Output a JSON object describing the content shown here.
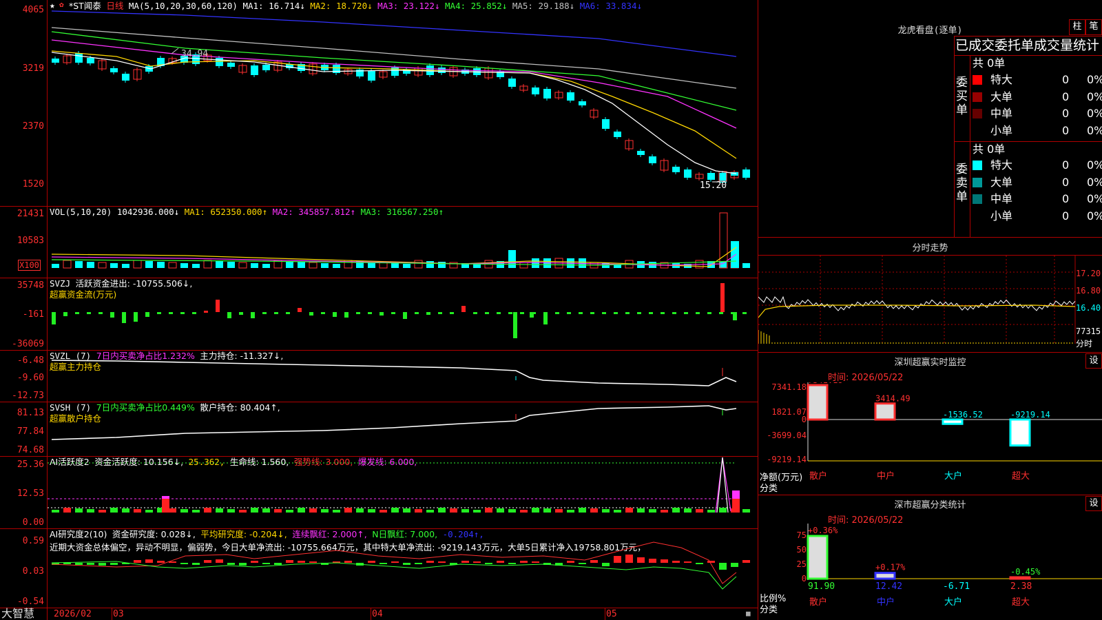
{
  "main": {
    "stock_name": "*ST闻泰",
    "period": "日线",
    "ma_header": {
      "label": "MA(5,10,20,30,60,120)",
      "ma1": "MA1: 16.714↓",
      "ma2": "MA2: 18.720↓",
      "ma3": "MA3: 23.122↓",
      "ma4": "MA4: 25.852↓",
      "ma5": "MA5: 29.188↓",
      "ma6": "MA6: 33.834↓"
    },
    "y_labels": [
      "4065",
      "3219",
      "2370",
      "1520"
    ],
    "high_label": "34.94",
    "low_label": "15.20"
  },
  "vol": {
    "header": {
      "label": "VOL(5,10,20)",
      "value": "1042936.000↓",
      "ma1": "MA1: 652350.000↑",
      "ma2": "MA2: 345857.812↑",
      "ma3": "MA3: 316567.250↑"
    },
    "y_labels": [
      "21431",
      "10583",
      "X100"
    ]
  },
  "svzj": {
    "header": {
      "label": "SVZJ",
      "text": "活跃资金进出: -10755.506↓,",
      "sub": "超赢资金流(万元)"
    },
    "y_labels": [
      "35748",
      "-161",
      "-36069"
    ]
  },
  "svzl": {
    "header": {
      "label": "SVZL (7)",
      "ratio": "7日内买卖净占比1.232%",
      "hold": "主力持仓: -11.327↓,",
      "sub": "超赢主力持仓"
    },
    "y_labels": [
      "-6.48",
      "-9.60",
      "-12.73"
    ]
  },
  "svsh": {
    "header": {
      "label": "SVSH (7)",
      "ratio": "7日内买卖净占比0.449%",
      "hold": "散户持仓: 80.404↑,",
      "sub": "超赢散户持仓"
    },
    "y_labels": [
      "81.13",
      "77.84",
      "74.68"
    ]
  },
  "ai_act": {
    "header": {
      "label": "AI活跃度2",
      "v1": "资金活跃度: 10.156↓,",
      "v2": "25.362,",
      "v3": "生命线: 1.560,",
      "v4": "强势线: 3.000,",
      "v5": "爆发线: 6.000,"
    },
    "y_labels": [
      "25.36",
      "12.53",
      "0.00"
    ]
  },
  "ai_res": {
    "header": {
      "label": "AI研究度2(10)",
      "v1": "资金研究度: 0.028↓,",
      "v2": "平均研究度: -0.204↓,",
      "v3": "连续飘红: 2.000↑,",
      "v4": "N日飘红: 7.000,",
      "v5": "-0.204↑,"
    },
    "comment": "近期大资金总体偏空，异动不明显，偏弱势，今日大单净流出: -10755.664万元，其中特大单净流出: -9219.143万元，大单5日累计净入19758.801万元，",
    "y_labels": [
      "0.59",
      "0.03",
      "-0.54"
    ]
  },
  "xaxis": {
    "brand": "大智慧",
    "labels": [
      "2026/02",
      "03",
      "04",
      "05"
    ]
  },
  "right": {
    "dragon_title": "龙虎看盘(逐单)",
    "btn_bar": "柱",
    "btn_pen": "笔",
    "order_title": "已成交委托单成交量统计",
    "buy": {
      "side_label": "委买单",
      "total": "共 0单",
      "rows": [
        {
          "name": "特大",
          "count": "0",
          "pct": "0%",
          "color": "#ff0000"
        },
        {
          "name": "大单",
          "count": "0",
          "pct": "0%",
          "color": "#990000"
        },
        {
          "name": "中单",
          "count": "0",
          "pct": "0%",
          "color": "#660000"
        },
        {
          "name": "小单",
          "count": "0",
          "pct": "0%",
          "color": "#000000"
        }
      ]
    },
    "sell": {
      "side_label": "委卖单",
      "total": "共 0单",
      "rows": [
        {
          "name": "特大",
          "count": "0",
          "pct": "0%",
          "color": "#00ffff"
        },
        {
          "name": "大单",
          "count": "0",
          "pct": "0%",
          "color": "#009999"
        },
        {
          "name": "中单",
          "count": "0",
          "pct": "0%",
          "color": "#007777"
        },
        {
          "name": "小单",
          "count": "0",
          "pct": "0%",
          "color": "#000000"
        }
      ]
    },
    "intraday": {
      "title": "分时走势",
      "y_labels": [
        "17.20",
        "16.80",
        "16.40",
        "77315",
        "分时"
      ]
    },
    "monitor": {
      "title": "深圳超赢实时监控",
      "btn": "设",
      "time": "时间: 2026/05/22",
      "y_labels": [
        "7341.18",
        "1821.07",
        "0",
        "-3699.04",
        "-9219.14"
      ],
      "unit": "净额(万元)",
      "cat_label": "分类",
      "bars": [
        {
          "cat": "散户",
          "value": 7341.18,
          "label": "7341.18"
        },
        {
          "cat": "中户",
          "value": 3414.49,
          "label": "3414.49"
        },
        {
          "cat": "大户",
          "value": -1536.52,
          "label": "-1536.52"
        },
        {
          "cat": "超大",
          "value": -9219.14,
          "label": "-9219.14"
        }
      ]
    },
    "classify": {
      "title": "深市超赢分类统计",
      "btn": "设",
      "time": "时间: 2026/05/22",
      "y_labels": [
        "75",
        "50",
        "25",
        "0"
      ],
      "unit": "比例%",
      "cat_label": "分类",
      "bars": [
        {
          "cat": "散户",
          "value": 91.9,
          "label": "91.90",
          "delta": "+0.36%"
        },
        {
          "cat": "中户",
          "value": 12.42,
          "label": "12.42",
          "delta": "+0.17%"
        },
        {
          "cat": "大户",
          "value": -6.71,
          "label": "-6.71",
          "delta": ""
        },
        {
          "cat": "超大",
          "value": 2.38,
          "label": "2.38",
          "delta": "-0.45%"
        }
      ]
    }
  }
}
